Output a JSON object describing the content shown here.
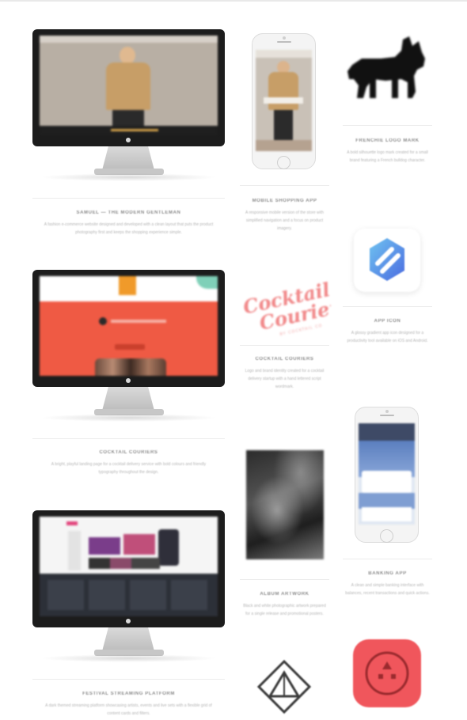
{
  "projects": [
    {
      "title": "Samuel — The Modern Gentleman",
      "text": "A fashion e-commerce website designed and developed with a clean layout that puts the product photography first and keeps the shopping experience simple."
    },
    {
      "title": "Cocktail Couriers",
      "text": "A bright, playful landing page for a cocktail delivery service with bold colours and friendly typography throughout the design."
    },
    {
      "title": "Festival Streaming Platform",
      "text": "A dark themed streaming platform showcasing artists, events and live sets with a flexible grid of content cards and filters."
    },
    {
      "title": "Mobile Shopping App",
      "text": "A responsive mobile version of the store with simplified navigation and a focus on product imagery."
    },
    {
      "title": "Cocktail Couriers",
      "text": "Logo and brand identity created for a cocktail delivery startup with a hand lettered script wordmark."
    },
    {
      "title": "Album Artwork",
      "text": "Black and white photographic artwork prepared for a single release and promotional posters."
    },
    {
      "title": "Frenchie Logo Mark",
      "text": "A bold silhouette logo mark created for a small brand featuring a French bulldog character."
    },
    {
      "title": "App Icon",
      "text": "A glossy gradient app icon designed for a productivity tool available on iOS and Android."
    },
    {
      "title": "Banking App",
      "text": "A clean and simple banking interface with balances, recent transactions and quick actions."
    }
  ],
  "cocktail_logo": {
    "line1": "Cocktail",
    "line2": "Couriers",
    "tag": "BY COCKTAIL CO"
  },
  "colors": {
    "coral": "#ef5a44",
    "cocktail_pink": "#f1898a",
    "app_red": "#f0565c",
    "app_blue_start": "#6fc3f0",
    "app_blue_end": "#4a6be0"
  },
  "icons": [
    "dog-silhouette-icon",
    "hexagon-s-logo-icon",
    "triangle-logo-icon",
    "red-app-icon"
  ]
}
